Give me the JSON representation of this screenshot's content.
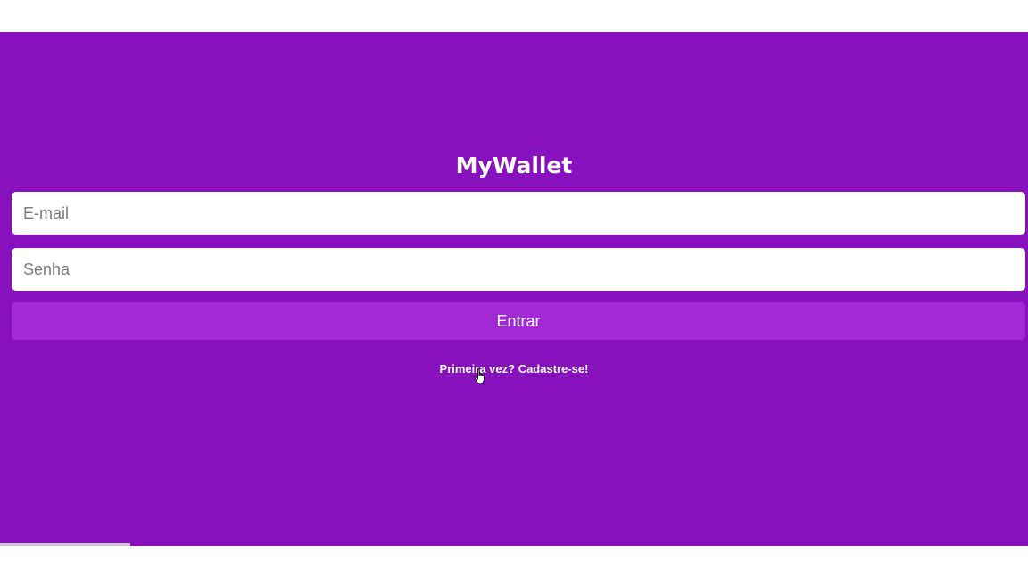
{
  "app": {
    "logo": "MyWallet"
  },
  "login": {
    "email_placeholder": "E-mail",
    "password_placeholder": "Senha",
    "submit_label": "Entrar",
    "signup_link": "Primeira vez? Cadastre-se!"
  },
  "colors": {
    "background": "#8611bd",
    "button": "#a328d6",
    "field": "#ffffff",
    "text": "#ffffff"
  },
  "icons": {
    "cursor": "hand-pointer-icon"
  }
}
